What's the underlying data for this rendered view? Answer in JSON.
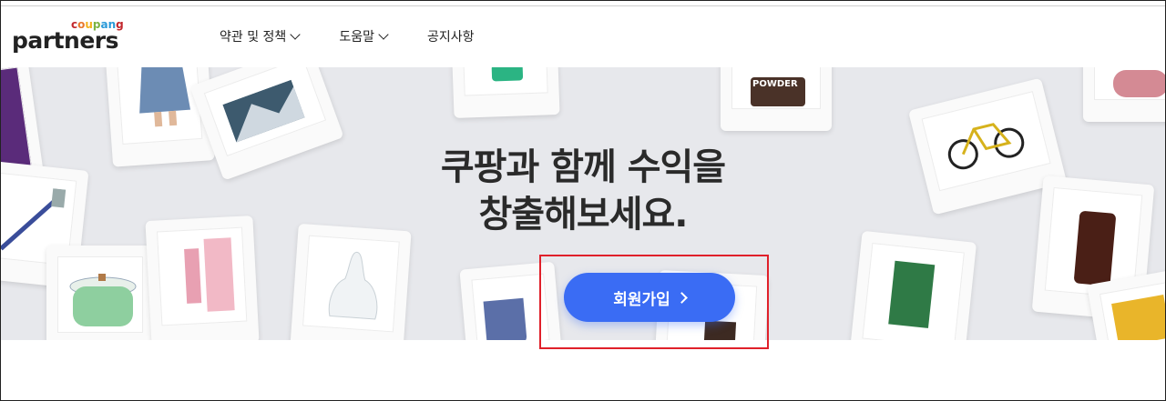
{
  "header": {
    "logo_small": "coupang",
    "logo_main": "partners",
    "nav": [
      {
        "label": "약관 및 정책"
      },
      {
        "label": "도움말"
      },
      {
        "label": "공지사항"
      }
    ]
  },
  "hero": {
    "headline_line1": "쿠팡과 함께 수익을",
    "headline_line2": "창출해보세요.",
    "cta_label": "회원가입",
    "product_label": "POWDER"
  },
  "colors": {
    "cta": "#3a6cf4",
    "hero_bg": "#e7e8ec",
    "highlight": "#e0202a"
  }
}
